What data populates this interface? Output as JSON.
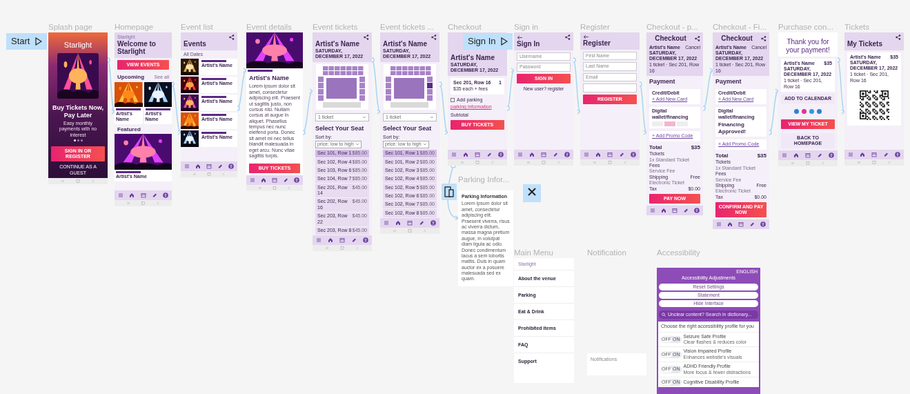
{
  "frames": [
    {
      "title": "Splash page",
      "kind": "splash",
      "flow_start": "Start",
      "links": [
        {
          "kind": "next"
        }
      ],
      "blocks": [
        {
          "kind": "logo",
          "text": "Starlight"
        },
        {
          "kind": "hero-picture"
        },
        {
          "kind": "headline",
          "text": "Buy Tickets Now, Pay Later"
        },
        {
          "kind": "caption",
          "text": "Easy monthly payments with no interest"
        },
        {
          "kind": "dots",
          "pages": [
            {
              "selected": true
            },
            {
              "selected": false
            },
            {
              "selected": false
            }
          ]
        },
        {
          "kind": "button",
          "label": "SIGN IN OR REGISTER"
        },
        {
          "kind": "link",
          "text": "CONTINUE AS A GUEST"
        },
        {
          "kind": "system-bar"
        }
      ]
    },
    {
      "title": "Homepage",
      "kind": "screen",
      "links": [
        {
          "kind": "next"
        }
      ],
      "blocks": [
        {
          "kind": "appbar",
          "logo": "Starlight",
          "title": "Welcome to Starlight"
        },
        {
          "kind": "button",
          "label": "VIEW EVENTS"
        },
        {
          "kind": "section",
          "title": "Upcoming",
          "more": "See all"
        },
        {
          "kind": "event-pair",
          "events": [
            {
              "name": "Artist's Name"
            },
            {
              "name": "Artist's Name"
            }
          ]
        },
        {
          "kind": "section",
          "title": "Featured"
        },
        {
          "kind": "banner-picture"
        },
        {
          "kind": "event-caption",
          "name": "Artist's Name"
        },
        {
          "kind": "tab-bar"
        },
        {
          "kind": "system-bar"
        }
      ]
    },
    {
      "title": "Event list",
      "kind": "screen",
      "links": [
        {
          "kind": "next"
        }
      ],
      "blocks": [
        {
          "kind": "appbar",
          "share": true,
          "title": "Events"
        },
        {
          "kind": "filter",
          "text": "All Dates"
        },
        {
          "kind": "event-row",
          "name": "Artist's Name"
        },
        {
          "kind": "event-row",
          "name": "Artist's Name"
        },
        {
          "kind": "event-row",
          "name": "Artist's Name"
        },
        {
          "kind": "event-row",
          "name": "Artist's Name"
        },
        {
          "kind": "event-row",
          "name": "Artist's Name"
        },
        {
          "kind": "tab-bar"
        },
        {
          "kind": "system-bar"
        }
      ]
    },
    {
      "title": "Event details",
      "kind": "media",
      "links": [
        {
          "kind": "next"
        }
      ],
      "blocks": [
        {
          "kind": "banner-picture"
        },
        {
          "kind": "tag"
        },
        {
          "kind": "headline",
          "text": "Artist's Name"
        },
        {
          "kind": "paragraph",
          "text": "Lorem ipsum dolor sit amet, consectetur adipiscing elit. Praesent ut sagittis justo, non cursus nisi. Nullam cursus at augue in aliquet. Phasellus tempus nec nunc eleifend porta. Donec sit amet mi nec tellus blandit malesuada in eget arcu. Nunc vitae sagittis turpis."
        },
        {
          "kind": "button",
          "label": "BUY TICKETS"
        },
        {
          "kind": "tab-bar"
        },
        {
          "kind": "system-bar"
        }
      ]
    },
    {
      "title": "Event tickets",
      "kind": "screen",
      "links": [
        {
          "kind": "next"
        }
      ],
      "blocks": [
        {
          "kind": "appbar",
          "share": true,
          "title": "Artist's Name",
          "subtitle": "SATURDAY, DECEMBER 17, 2022"
        },
        {
          "kind": "seat-map",
          "highlighted": false
        },
        {
          "kind": "dropdown",
          "value": "1 ticket"
        },
        {
          "kind": "headline",
          "text": "Select Your Seat"
        },
        {
          "kind": "sort",
          "label": "Sort by:",
          "value": "price: low to high"
        },
        {
          "kind": "seat-row",
          "seat": "Sec 101, Row 1",
          "price": "$85.00",
          "selected": true
        },
        {
          "kind": "seat-row",
          "seat": "Sec 102, Row 4",
          "price": "$85.00",
          "selected": false
        },
        {
          "kind": "seat-row",
          "seat": "Sec 103, Row 6",
          "price": "$85.00",
          "selected": false
        },
        {
          "kind": "seat-row",
          "seat": "Sec 104, Row 7",
          "price": "$85.00",
          "selected": false
        },
        {
          "kind": "seat-row",
          "seat": "Sec 201, Row 14",
          "price": "$45.00",
          "selected": false
        },
        {
          "kind": "seat-row",
          "seat": "Sec 202, Row 16",
          "price": "$45.00",
          "selected": false
        },
        {
          "kind": "seat-row",
          "seat": "Sec 203, Row 22",
          "price": "$45.00",
          "selected": false
        },
        {
          "kind": "seat-row",
          "seat": "Sec 203, Row 8",
          "price": "$45.00",
          "selected": false
        },
        {
          "kind": "tab-bar"
        },
        {
          "kind": "system-bar"
        }
      ]
    },
    {
      "title": "Event tickets ...",
      "kind": "screen",
      "links": [
        {
          "kind": "next"
        }
      ],
      "blocks": [
        {
          "kind": "appbar",
          "share": true,
          "title": "Artist's Name",
          "subtitle": "SATURDAY, DECEMBER 17, 2022"
        },
        {
          "kind": "seat-map",
          "highlighted": true
        },
        {
          "kind": "dropdown",
          "value": "1 ticket"
        },
        {
          "kind": "headline",
          "text": "Select Your Seat"
        },
        {
          "kind": "sort",
          "label": "Sort by:",
          "value": "price: low to high"
        },
        {
          "kind": "seat-row",
          "seat": "Sec 101, Row 1",
          "price": "$85.00",
          "selected": true
        },
        {
          "kind": "seat-row",
          "seat": "Sec 101, Row 2",
          "price": "$85.00",
          "selected": false
        },
        {
          "kind": "seat-row",
          "seat": "Sec 102, Row 3",
          "price": "$85.00",
          "selected": false
        },
        {
          "kind": "seat-row",
          "seat": "Sec 102, Row 4",
          "price": "$85.00",
          "selected": false
        },
        {
          "kind": "seat-row",
          "seat": "Sec 102, Row 5",
          "price": "$85.00",
          "selected": false
        },
        {
          "kind": "seat-row",
          "seat": "Sec 102, Row 6",
          "price": "$85.00",
          "selected": false
        },
        {
          "kind": "seat-row",
          "seat": "Sec 102, Row 7",
          "price": "$85.00",
          "selected": false
        },
        {
          "kind": "seat-row",
          "seat": "Sec 102, Row 8",
          "price": "$85.00",
          "selected": false
        },
        {
          "kind": "tab-bar"
        },
        {
          "kind": "system-bar"
        }
      ]
    },
    {
      "title": "Checkout",
      "kind": "screen",
      "links": [
        {
          "kind": "next"
        },
        {
          "kind": "overlay"
        }
      ],
      "blocks": [
        {
          "kind": "appbar",
          "title": "Artist's Name",
          "subtitle": "SATURDAY, DECEMBER 17, 2022"
        },
        {
          "kind": "ticket-line",
          "seat": "Sec 201, Row 16",
          "qty": "1",
          "note": "$35 each + fees"
        },
        {
          "kind": "checkbox",
          "label": "Add parking",
          "checked": false
        },
        {
          "kind": "link",
          "text": "parking information"
        },
        {
          "kind": "summary",
          "label": "Subtotal"
        },
        {
          "kind": "button",
          "label": "BUY TICKETS"
        },
        {
          "kind": "tab-bar"
        },
        {
          "kind": "system-bar"
        }
      ]
    },
    {
      "title": "Sign in",
      "kind": "screen",
      "flow_start": "Sign In",
      "links": [
        {
          "kind": "next"
        }
      ],
      "blocks": [
        {
          "kind": "appbar",
          "back": true,
          "share": true,
          "title": "Sign In"
        },
        {
          "kind": "field",
          "placeholder": "Username"
        },
        {
          "kind": "field",
          "placeholder": "Password"
        },
        {
          "kind": "button",
          "label": "SIGN IN"
        },
        {
          "kind": "note",
          "text": "New user?",
          "link": "register"
        },
        {
          "kind": "tab-bar"
        },
        {
          "kind": "system-bar"
        }
      ]
    },
    {
      "title": "Register",
      "kind": "screen",
      "links": [
        {
          "kind": "next"
        }
      ],
      "blocks": [
        {
          "kind": "appbar",
          "back": true,
          "title": "Register"
        },
        {
          "kind": "field",
          "placeholder": "First Name"
        },
        {
          "kind": "field",
          "placeholder": "Last Name"
        },
        {
          "kind": "field",
          "placeholder": "Email"
        },
        {
          "kind": "field"
        },
        {
          "kind": "button",
          "label": "REGISTER"
        },
        {
          "kind": "tab-bar"
        },
        {
          "kind": "system-bar"
        }
      ]
    },
    {
      "title": "Checkout - p...",
      "kind": "screen",
      "links": [
        {
          "kind": "next"
        }
      ],
      "blocks": [
        {
          "kind": "appbar",
          "centered": true,
          "share": true,
          "title": "Checkout"
        },
        {
          "kind": "order-header",
          "name": "Artist's Name",
          "action": "Cancel",
          "date": "SATURDAY, DECEMBER 17, 2022",
          "line": "1 ticket · Sec 201, Row 16"
        },
        {
          "kind": "headline",
          "text": "Payment"
        },
        {
          "kind": "payment-card",
          "title": "Credit/Debit",
          "link": "+ Add New Card"
        },
        {
          "kind": "payment-card",
          "title": "Digital wallet/financing",
          "options": [
            {
              "selected": false
            },
            {
              "selected": true
            },
            {
              "selected": false
            }
          ]
        },
        {
          "kind": "payment-card",
          "link": "+ Add Promo Code"
        },
        {
          "kind": "total",
          "label": "Total",
          "value": "$35"
        },
        {
          "kind": "summary",
          "label": "Tickets",
          "sub": "1x Standard Ticket"
        },
        {
          "kind": "summary",
          "label": "Fees",
          "sub": "Service Fee"
        },
        {
          "kind": "summary",
          "label": "Shipping",
          "sub": "Electronic Ticket",
          "value": "Free"
        },
        {
          "kind": "summary",
          "label": "Tax",
          "value": "$0.00"
        },
        {
          "kind": "button",
          "label": "PAY NOW"
        },
        {
          "kind": "tab-bar"
        }
      ]
    },
    {
      "title": "Checkout - Fi...",
      "kind": "screen",
      "links": [
        {
          "kind": "next"
        }
      ],
      "blocks": [
        {
          "kind": "appbar",
          "centered": true,
          "share": true,
          "title": "Checkout"
        },
        {
          "kind": "order-header",
          "name": "Artist's Name",
          "action": "Cancel",
          "date": "SATURDAY, DECEMBER 17, 2022",
          "line": "1 ticket · Sec 201, Row 16"
        },
        {
          "kind": "headline",
          "text": "Payment"
        },
        {
          "kind": "payment-card",
          "title": "Credit/Debit",
          "link": "+ Add New Card"
        },
        {
          "kind": "payment-card",
          "title": "Digital wallet/financing",
          "status": "Financing Approved!"
        },
        {
          "kind": "payment-card",
          "link": "+ Add Promo Code"
        },
        {
          "kind": "total",
          "label": "Total",
          "value": "$35"
        },
        {
          "kind": "summary",
          "label": "Tickets",
          "sub": "1x Standard Ticket"
        },
        {
          "kind": "summary",
          "label": "Fees",
          "sub": "Service Fee"
        },
        {
          "kind": "summary",
          "label": "Shipping",
          "sub": "Electronic Ticket",
          "value": "Free"
        },
        {
          "kind": "summary",
          "label": "Tax",
          "value": "$0.00"
        },
        {
          "kind": "button",
          "label": "CONFIRM AND PAY NOW"
        },
        {
          "kind": "tab-bar"
        }
      ]
    },
    {
      "title": "Purchase con...",
      "kind": "screen",
      "links": [
        {
          "kind": "next"
        }
      ],
      "blocks": [
        {
          "kind": "thanks",
          "text": "Thank you for your payment!"
        },
        {
          "kind": "order-card",
          "name": "Artist's Name",
          "price": "$35",
          "date": "SATURDAY, DECEMBER 17, 2022",
          "line": "1 ticket · Sec 201, Row 16"
        },
        {
          "kind": "outline-button",
          "label": "ADD TO CALENDAR"
        },
        {
          "kind": "share-icons",
          "icons": [
            {
              "color": "#2f7fd6"
            },
            {
              "color": "#e0338f"
            },
            {
              "color": "#2d9be0"
            },
            {
              "color": "#2f7fd6"
            }
          ]
        },
        {
          "kind": "button",
          "label": "VIEW MY TICKET"
        },
        {
          "kind": "outline-button",
          "label": "BACK TO HOMEPAGE"
        },
        {
          "kind": "tab-bar"
        },
        {
          "kind": "system-bar"
        }
      ]
    },
    {
      "title": "Tickets",
      "kind": "screen",
      "blocks": [
        {
          "kind": "appbar",
          "share": true,
          "title": "My Tickets"
        },
        {
          "kind": "order-card",
          "name": "Artist's Name",
          "price": "$35",
          "date": "SATURDAY, DECEMBER 17, 2022",
          "line": "1 ticket · Sec 201, Row 16"
        },
        {
          "kind": "qr-code"
        },
        {
          "kind": "tab-bar"
        },
        {
          "kind": "system-bar"
        }
      ]
    },
    {
      "title": "Parking Infor...",
      "kind": "card",
      "badges": [
        {
          "kind": "overlay"
        },
        {
          "kind": "close"
        }
      ],
      "blocks": [
        {
          "kind": "card-title",
          "text": "Parking Information"
        },
        {
          "kind": "paragraph",
          "text": "Lorem ipsum dolor sit amet, consectetur adipiscing elit. Praesent viverra, risus ac viverra dictum, massa magna pretium augue, in volutpat diam ligula ac odio. Donec condimentum lacus a sem lobortis mattis. Duis in quam auctor ex a posuere malesuada sed ex quam."
        }
      ]
    },
    {
      "title": "Main Menu",
      "kind": "menu",
      "blocks": [
        {
          "kind": "logo-small",
          "text": "Starlight"
        },
        {
          "kind": "menu-item",
          "label": "About the venue"
        },
        {
          "kind": "menu-item",
          "label": "Parking"
        },
        {
          "kind": "menu-item",
          "label": "Eat & Drink"
        },
        {
          "kind": "menu-item",
          "label": "Prohibited items"
        },
        {
          "kind": "menu-item",
          "label": "FAQ"
        },
        {
          "kind": "menu-item",
          "label": "Support"
        }
      ]
    },
    {
      "title": "Notification",
      "kind": "card",
      "blocks": [
        {
          "kind": "faint-title",
          "text": "Notifications"
        }
      ]
    },
    {
      "title": "Accessibility",
      "kind": "panel",
      "blocks": [
        {
          "kind": "lang",
          "text": "ENGLISH"
        },
        {
          "kind": "a11y-title",
          "text": "Accessibility Adjustments"
        },
        {
          "kind": "pill",
          "label": "Reset Settings"
        },
        {
          "kind": "pill",
          "label": "Statement"
        },
        {
          "kind": "pill",
          "label": "Hide Interface"
        },
        {
          "kind": "search",
          "placeholder": "Unclear content? Search in dictionary..."
        },
        {
          "kind": "a11y-note",
          "text": "Choose the right accessibility profile for you"
        },
        {
          "kind": "profile",
          "name": "Seizure Safe Profile",
          "desc": "Clear flashes & reduces color",
          "on": false,
          "off_label": "OFF",
          "on_label": "ON"
        },
        {
          "kind": "profile",
          "name": "Vision Impaired Profile",
          "desc": "Enhances website's visuals",
          "on": false,
          "off_label": "OFF",
          "on_label": "ON"
        },
        {
          "kind": "profile",
          "name": "ADHD Friendly Profile",
          "desc": "More focus & fewer distractions",
          "on": false,
          "off_label": "OFF",
          "on_label": "ON"
        },
        {
          "kind": "profile",
          "name": "Cognitive Disability Profile",
          "on": false,
          "off_label": "OFF",
          "on_label": "ON"
        }
      ]
    }
  ]
}
